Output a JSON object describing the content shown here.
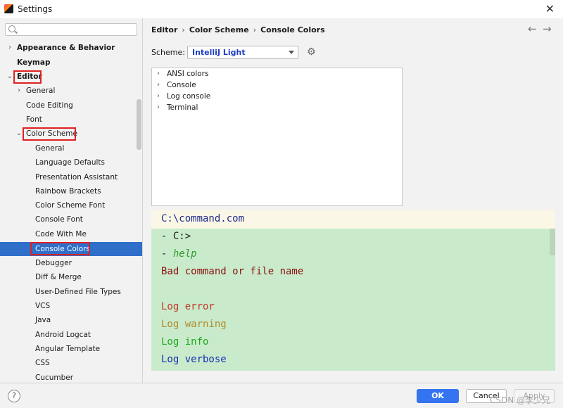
{
  "window": {
    "title": "Settings"
  },
  "search": {
    "placeholder": ""
  },
  "sidebar": {
    "items": [
      {
        "label": "Appearance & Behavior",
        "chevron": "›"
      },
      {
        "label": "Keymap"
      },
      {
        "label": "Editor",
        "chevron": "⌄"
      },
      {
        "label": "General",
        "chevron": "›"
      },
      {
        "label": "Code Editing"
      },
      {
        "label": "Font"
      },
      {
        "label": "Color Scheme",
        "chevron": "⌄"
      },
      {
        "label": "General"
      },
      {
        "label": "Language Defaults"
      },
      {
        "label": "Presentation Assistant"
      },
      {
        "label": "Rainbow Brackets"
      },
      {
        "label": "Color Scheme Font"
      },
      {
        "label": "Console Font"
      },
      {
        "label": "Code With Me"
      },
      {
        "label": "Console Colors"
      },
      {
        "label": "Debugger"
      },
      {
        "label": "Diff & Merge"
      },
      {
        "label": "User-Defined File Types"
      },
      {
        "label": "VCS"
      },
      {
        "label": "Java"
      },
      {
        "label": "Android Logcat"
      },
      {
        "label": "Angular Template"
      },
      {
        "label": "CSS"
      },
      {
        "label": "Cucumber"
      }
    ]
  },
  "breadcrumb": {
    "part1": "Editor",
    "part2": "Color Scheme",
    "part3": "Console Colors",
    "sep": "›"
  },
  "nav": {
    "back": "←",
    "forward": "→"
  },
  "scheme": {
    "label": "Scheme:",
    "value": "IntelliJ Light"
  },
  "categories": [
    {
      "label": "ANSI colors",
      "chevron": "›"
    },
    {
      "label": "Console",
      "chevron": "›"
    },
    {
      "label": "Log console",
      "chevron": "›"
    },
    {
      "label": "Terminal",
      "chevron": "›"
    }
  ],
  "preview": {
    "lines": [
      {
        "text": "C:\\command.com",
        "color": "#1e2a8c"
      },
      {
        "text": "- C:>",
        "color": "#1a1a1a"
      },
      {
        "text": "- help",
        "color": "#2f9a2f",
        "italic_part": "help"
      },
      {
        "text": "Bad command or file name",
        "color": "#8b1010"
      },
      {
        "text": "",
        "color": "#1a1a1a"
      },
      {
        "text": "Log error",
        "color": "#c0392b"
      },
      {
        "text": "Log warning",
        "color": "#b08a2a"
      },
      {
        "text": "Log info",
        "color": "#1faa1f"
      },
      {
        "text": "Log verbose",
        "color": "#1530b0"
      }
    ],
    "background": "#c9ebcb",
    "first_line_background": "#fbf7e6"
  },
  "buttons": {
    "help": "?",
    "ok": "OK",
    "cancel": "Cancel",
    "apply": "Apply"
  },
  "watermark": "CSDN @李少兄",
  "colors": {
    "accent": "#3574f0",
    "selection": "#2f6fc9",
    "highlight_box": "#e02020"
  }
}
